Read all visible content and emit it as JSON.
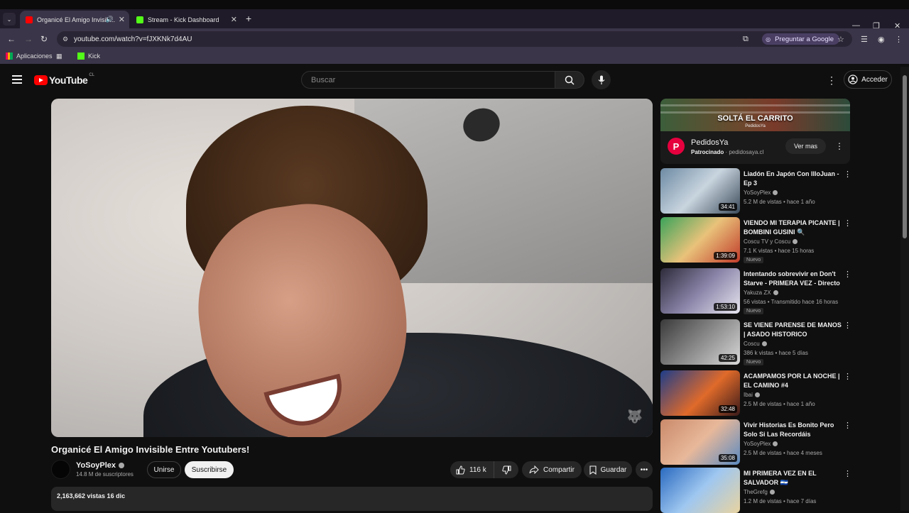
{
  "browser": {
    "tabs": [
      {
        "title": "Organicé El Amigo Invisib..."
      },
      {
        "title": "Stream - Kick Dashboard"
      }
    ],
    "url": "youtube.com/watch?v=fJXKNk7d4AU",
    "ask_google": "Preguntar a Google",
    "bookmarks": [
      "Aplicaciones",
      "Kick"
    ]
  },
  "header": {
    "logo_text": "YouTube",
    "country": "CL",
    "search_placeholder": "Buscar",
    "signin_label": "Acceder"
  },
  "video": {
    "title": "Organicé El Amigo Invisible Entre Youtubers!",
    "channel": "YoSoyPlex",
    "subscribers": "14.8 M de suscriptores",
    "join_label": "Unirse",
    "subscribe_label": "Suscribirse",
    "likes": "116 k",
    "share_label": "Compartir",
    "save_label": "Guardar",
    "description_meta": "2,163,662 vistas  16 dic"
  },
  "ad": {
    "headline": "SOLTÁ EL CARRITO",
    "banner_sub": "PedidosYa",
    "advertiser": "PedidosYa",
    "sponsored": "Patrocinado",
    "domain": "pedidosaya.cl",
    "cta": "Ver mas",
    "logo_letter": "P"
  },
  "recommendations": [
    {
      "title": "Liadón En Japón Con IlloJuan - Ep 3",
      "channel": "YoSoyPlex",
      "meta": "5.2 M de vistas • hace 1 año",
      "duration": "34:41",
      "badge": ""
    },
    {
      "title": "VIENDO MI TERAPIA PICANTE | BOMBINI GUSINI 🔍",
      "channel": "Coscu TV y Coscu",
      "meta": "7.1 K vistas • hace 15 horas",
      "duration": "1:39:09",
      "badge": "Nuevo"
    },
    {
      "title": "Intentando sobrevivir en Don't Starve - PRIMERA VEZ - Directo",
      "channel": "Yakuza ZX",
      "meta": "56 vistas • Transmitido hace 16 horas",
      "duration": "1:53:10",
      "badge": "Nuevo"
    },
    {
      "title": "SE VIENE PARENSE DE MANOS | ASADO HISTORICO",
      "channel": "Coscu",
      "meta": "386 k vistas • hace 5 días",
      "duration": "42:25",
      "badge": "Nuevo"
    },
    {
      "title": "ACAMPAMOS POR LA NOCHE | EL CAMINO #4",
      "channel": "Ibai",
      "meta": "2.5 M de vistas • hace 1 año",
      "duration": "32:48",
      "badge": ""
    },
    {
      "title": "Vivir Historias Es Bonito Pero Solo Si Las Recordáis",
      "channel": "YoSoyPlex",
      "meta": "2.5 M de vistas • hace 4 meses",
      "duration": "35:08",
      "badge": ""
    },
    {
      "title": "MI PRIMERA VEZ EN EL SALVADOR 🇸🇻",
      "channel": "TheGrefg",
      "meta": "1.2 M de vistas • hace 7 días",
      "duration": "",
      "badge": ""
    }
  ],
  "colors": {
    "background": "#0f0f0f",
    "accent_red": "#ff0000",
    "pedidosya": "#e6003e",
    "chrome": "#3b3549"
  }
}
